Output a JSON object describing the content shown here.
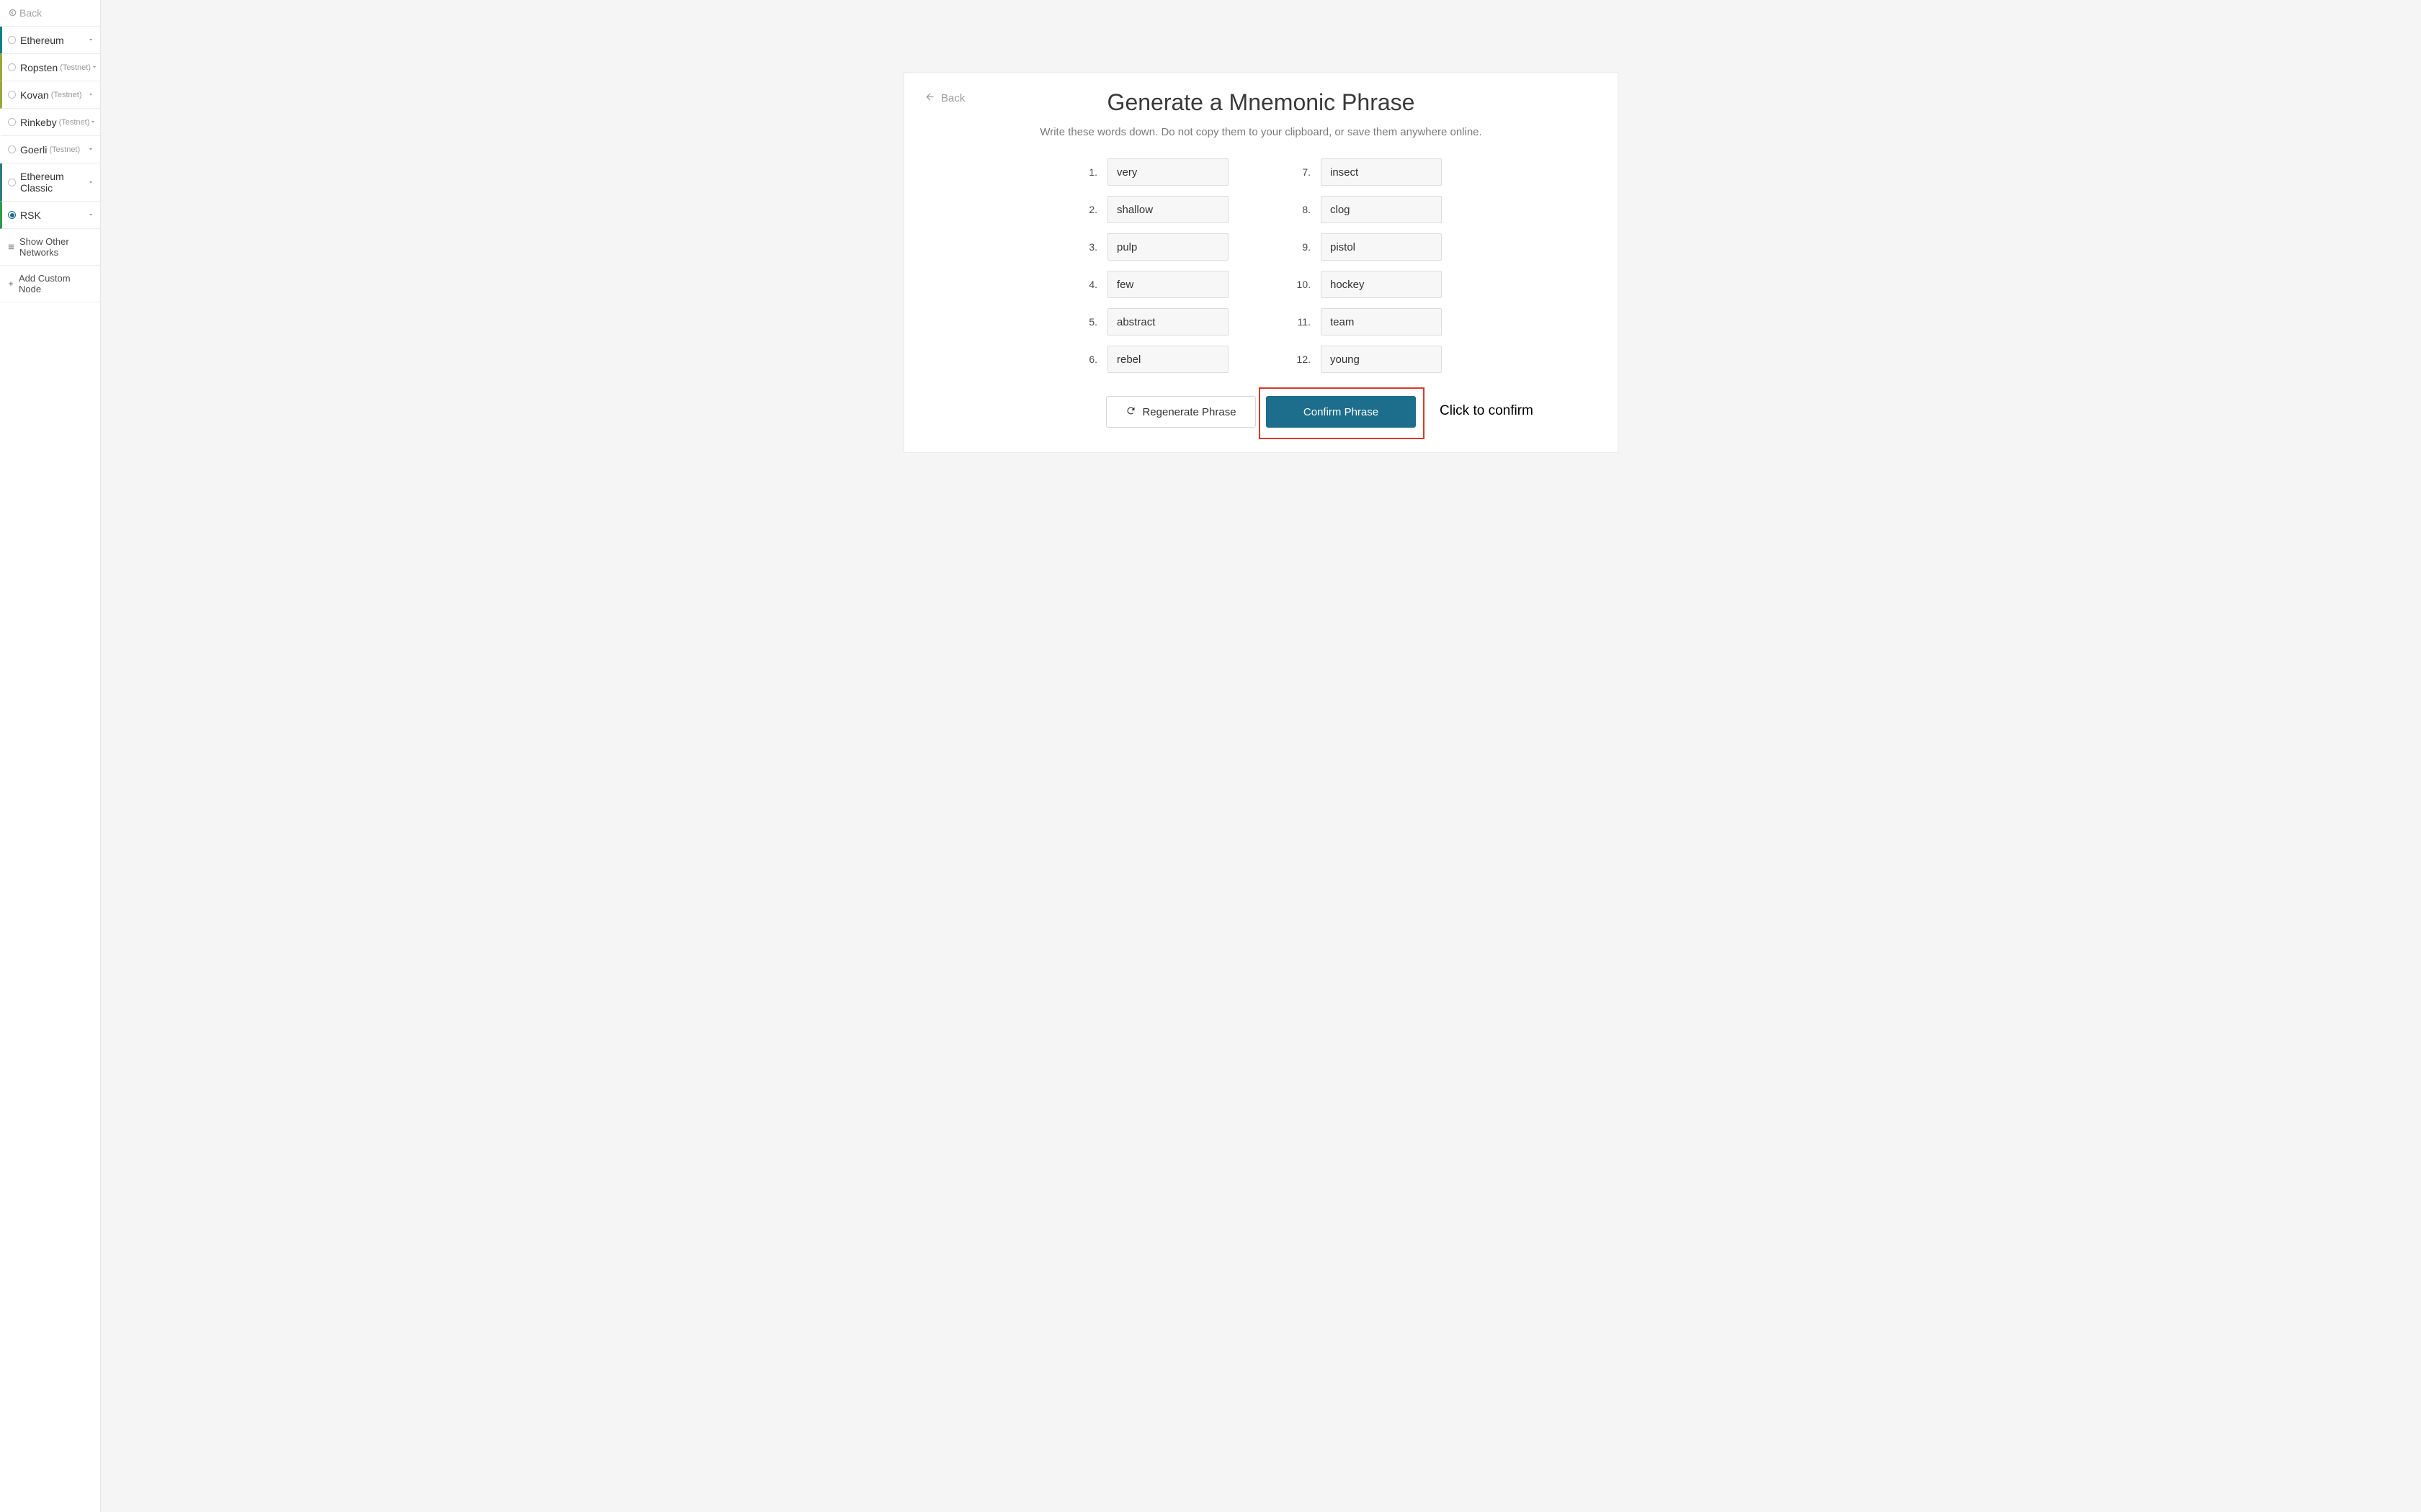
{
  "sidebar": {
    "back_label": "Back",
    "networks": [
      {
        "label": "Ethereum",
        "suffix": "",
        "selected": false,
        "stripe": "stripe-teal"
      },
      {
        "label": "Ropsten",
        "suffix": "(Testnet)",
        "selected": false,
        "stripe": "stripe-olive"
      },
      {
        "label": "Kovan",
        "suffix": "(Testnet)",
        "selected": false,
        "stripe": "stripe-olive"
      },
      {
        "label": "Rinkeby",
        "suffix": "(Testnet)",
        "selected": false,
        "stripe": ""
      },
      {
        "label": "Goerli",
        "suffix": "(Testnet)",
        "selected": false,
        "stripe": ""
      },
      {
        "label": "Ethereum Classic",
        "suffix": "",
        "selected": false,
        "stripe": "stripe-teal2"
      },
      {
        "label": "RSK",
        "suffix": "",
        "selected": true,
        "stripe": "stripe-green"
      }
    ],
    "show_other_label": "Show Other Networks",
    "add_custom_label": "Add Custom Node"
  },
  "card": {
    "back_label": "Back",
    "title": "Generate a Mnemonic Phrase",
    "subtitle": "Write these words down. Do not copy them to your clipboard, or save them anywhere online.",
    "words": [
      "very",
      "shallow",
      "pulp",
      "few",
      "abstract",
      "rebel",
      "insect",
      "clog",
      "pistol",
      "hockey",
      "team",
      "young"
    ],
    "regenerate_label": "Regenerate Phrase",
    "confirm_label": "Confirm Phrase"
  },
  "annotation": {
    "click_to_confirm": "Click to confirm"
  }
}
